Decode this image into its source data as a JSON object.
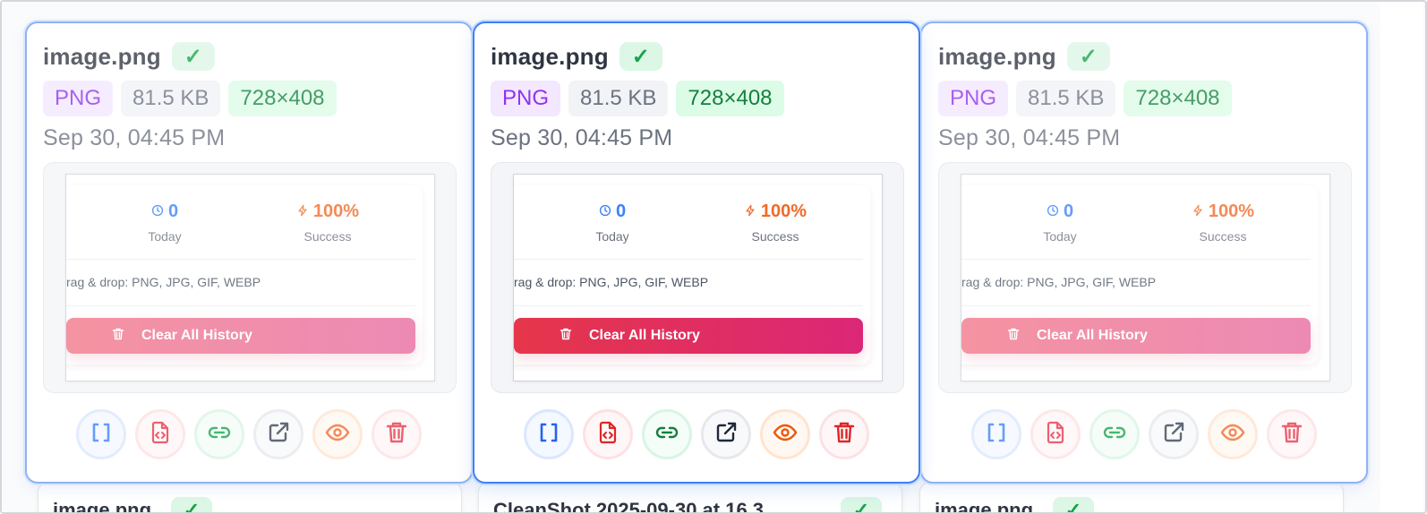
{
  "cards": [
    {
      "filename": "image.png",
      "check": "✓",
      "chips": {
        "type": "PNG",
        "size": "81.5 KB",
        "dims": "728×408"
      },
      "date": "Sep 30, 04:45 PM",
      "preview": {
        "stats": [
          {
            "value": "0",
            "label": "Today",
            "icon": "clock-icon"
          },
          {
            "value": "100%",
            "label": "Success",
            "icon": "bolt-icon"
          }
        ],
        "formats": "rag & drop: PNG, JPG, GIF, WEBP",
        "clear_label": "Clear All History"
      },
      "actions": [
        "brackets-icon",
        "file-code-icon",
        "link-icon",
        "external-link-icon",
        "eye-icon",
        "trash-icon"
      ]
    },
    {
      "filename": "image.png",
      "check": "✓",
      "chips": {
        "type": "PNG",
        "size": "81.5 KB",
        "dims": "728×408"
      },
      "date": "Sep 30, 04:45 PM",
      "preview": {
        "stats": [
          {
            "value": "0",
            "label": "Today",
            "icon": "clock-icon"
          },
          {
            "value": "100%",
            "label": "Success",
            "icon": "bolt-icon"
          }
        ],
        "formats": "rag & drop: PNG, JPG, GIF, WEBP",
        "clear_label": "Clear All History"
      },
      "actions": [
        "brackets-icon",
        "file-code-icon",
        "link-icon",
        "external-link-icon",
        "eye-icon",
        "trash-icon"
      ]
    },
    {
      "filename": "image.png",
      "check": "✓",
      "chips": {
        "type": "PNG",
        "size": "81.5 KB",
        "dims": "728×408"
      },
      "date": "Sep 30, 04:45 PM",
      "preview": {
        "stats": [
          {
            "value": "0",
            "label": "Today",
            "icon": "clock-icon"
          },
          {
            "value": "100%",
            "label": "Success",
            "icon": "bolt-icon"
          }
        ],
        "formats": "rag & drop: PNG, JPG, GIF, WEBP",
        "clear_label": "Clear All History"
      },
      "actions": [
        "brackets-icon",
        "file-code-icon",
        "link-icon",
        "external-link-icon",
        "eye-icon",
        "trash-icon"
      ]
    }
  ],
  "next_row": [
    {
      "filename": "image.png",
      "check": "✓"
    },
    {
      "filename": "CleanShot 2025-09-30 at 16.3",
      "check": "✓"
    },
    {
      "filename": "image.png",
      "check": "✓"
    }
  ],
  "colors": {
    "accent_blue": "#3b82f6",
    "success_green": "#16a34a",
    "type_purple": "#9333ea",
    "danger_red": "#e5364a",
    "warning_orange": "#f06a28"
  }
}
